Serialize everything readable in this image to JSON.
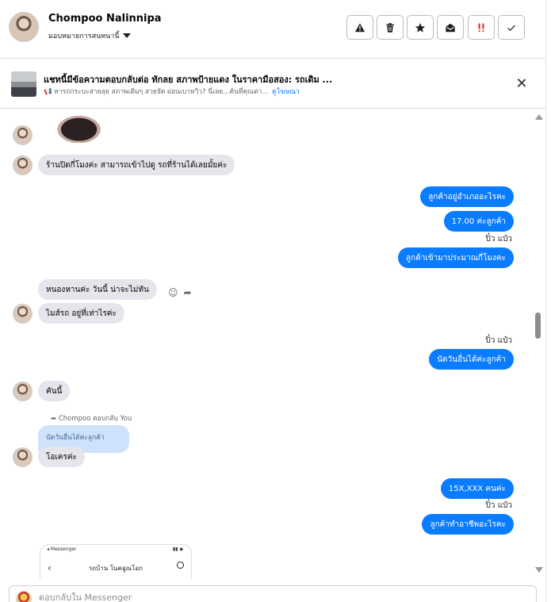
{
  "header": {
    "contact_name": "Chompoo Nalinnipa",
    "assign_label": "มอบหมายการสนทนานี้",
    "toolbar": {
      "spam_icon": "alert-triangle-icon",
      "delete_icon": "trash-icon",
      "star_icon": "star-icon",
      "unread_icon": "envelope-open-icon",
      "followup_icon": "double-exclamation-icon",
      "done_icon": "check-icon"
    }
  },
  "ad_banner": {
    "title": "แชทนี้มีข้อความตอบกลับต่อ ทักลย สภาพป้ายแดง ในราคามือสอง: รถเดิม ...",
    "subtitle": "📢 หารถกระบะสายลุย สภาพเดิมๆ สวยจัด ผ่อนเบาหวิว? นี่เลย...ค้นที่คุณตา...",
    "link": "ดูโฆษณา"
  },
  "messages": {
    "in_1": "ร้านปิดกี่โมงค่ะ สามารถเข้าไปดู รถที่ร้านได้เลยมั้ยค่ะ",
    "out_1": "ลูกค้าอยู่อำเภออะไรคะ",
    "out_2": "17.00 ค่ะลูกค้า",
    "seen_1": "ปิ๋ว แป๋ว",
    "out_3": "ลูกค้าเข้ามาประมาณกี่โมงคะ",
    "in_2": "หนองหานค่ะ วันนี้ น่าจะไม่ทัน",
    "in_3": "ไมส์รถ อยู่ที่เท่าไรค่ะ",
    "seen_2": "ปิ๋ว แป๋ว",
    "out_4": "นัดวันอื่นได้ค่ะลูกค้า",
    "in_4": "คันนี้",
    "reply_meta": "Chompoo ตอบกลับ You",
    "quoted": "นัดวันอื่นได้ค่ะลูกค้า",
    "in_5": "โอเครค่ะ",
    "out_5": "15X,XXX คนค่ะ",
    "seen_3": "ปิ๋ว แป๋ว",
    "out_6": "ลูกค้าทำอาชีพอะไรคะ",
    "shot_status": "◂ Messenger",
    "shot_title": "รถบ้าน โนคอูณโอก"
  },
  "composer": {
    "placeholder": "ตอบกลับใน Messenger"
  },
  "colors": {
    "accent": "#0a7cff",
    "incoming_bubble": "#e4e6eb",
    "quoted_bubble": "#cfe2fc"
  }
}
